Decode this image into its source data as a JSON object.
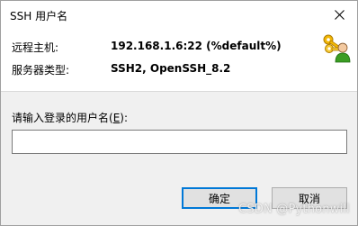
{
  "window": {
    "title": "SSH 用户名",
    "close_icon": "close-icon"
  },
  "info": {
    "host_label": "远程主机:",
    "host_value": "192.168.1.6:22  (%default%)",
    "server_type_label": "服务器类型:",
    "server_type_value": "SSH2, OpenSSH_8.2",
    "icon": "keys-user-icon"
  },
  "form": {
    "prompt_prefix": "请输入登录的用户名(",
    "prompt_accel": "E",
    "prompt_suffix": "):",
    "username_value": "",
    "username_placeholder": ""
  },
  "buttons": {
    "ok_label": "确定",
    "cancel_label": "取消"
  },
  "watermark": "CSDN @Pythonwill",
  "colors": {
    "focus_border": "#0078d7",
    "dialog_bg": "#f0f0f0"
  }
}
